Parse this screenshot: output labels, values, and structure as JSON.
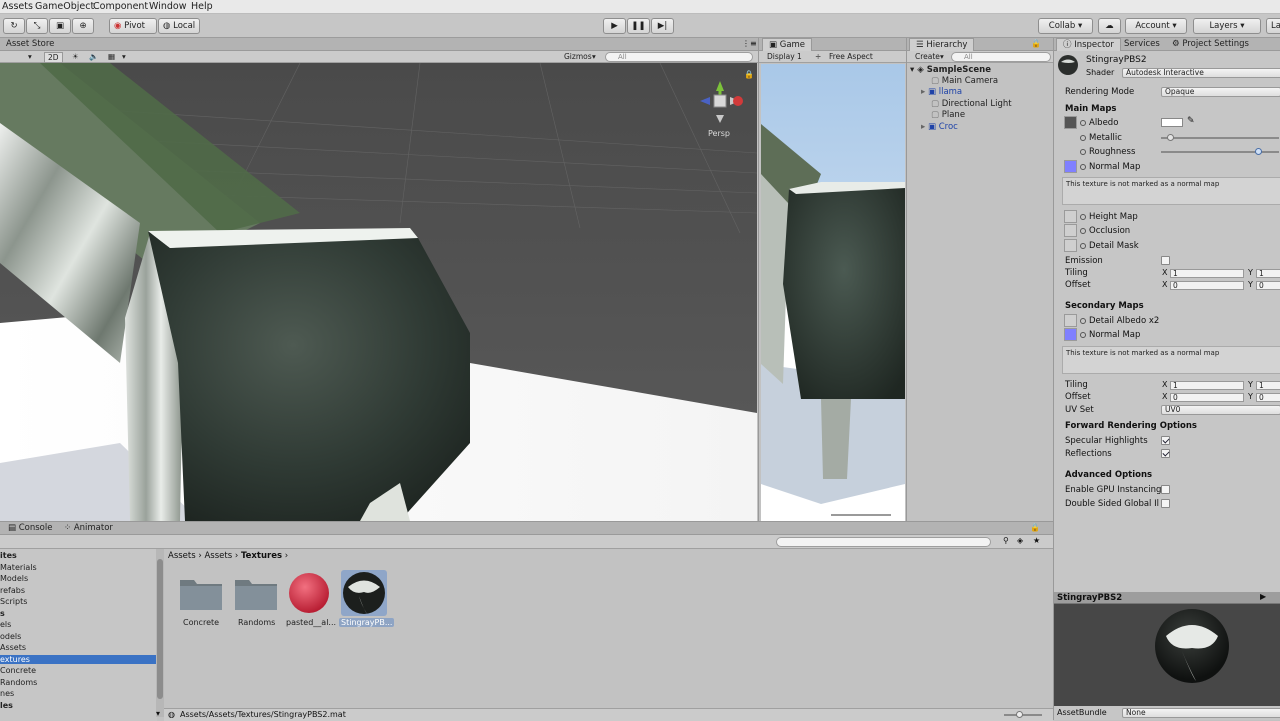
{
  "menu": [
    "Assets",
    "GameObject",
    "Component",
    "Window",
    "Help"
  ],
  "toolbar": {
    "pivot": "Pivot",
    "local": "Local",
    "collab": "Collab",
    "account": "Account",
    "layers": "Layers",
    "layout": "La"
  },
  "scene": {
    "tab": "Asset Store",
    "mode_2d": "2D",
    "gizmos": "Gizmos",
    "search_placeholder": "All",
    "persp": "Persp"
  },
  "game": {
    "tab": "Game",
    "display": "Display 1",
    "aspect": "Free Aspect"
  },
  "hierarchy": {
    "tab": "Hierarchy",
    "create": "Create",
    "search_placeholder": "All",
    "scene": "SampleScene",
    "items": [
      {
        "label": "Main Camera",
        "color": "#222222"
      },
      {
        "label": "llama",
        "color": "#1f43a8"
      },
      {
        "label": "Directional Light",
        "color": "#222222"
      },
      {
        "label": "Plane",
        "color": "#222222"
      },
      {
        "label": "Croc",
        "color": "#1f43a8"
      }
    ]
  },
  "inspector": {
    "tabs": [
      "Inspector",
      "Services",
      "Project Settings"
    ],
    "material_name": "StingrayPBS2",
    "shader_label": "Shader",
    "shader_value": "Autodesk Interactive",
    "rendering_mode_label": "Rendering Mode",
    "rendering_mode_value": "Opaque",
    "main_maps": "Main Maps",
    "albedo": "Albedo",
    "metallic": "Metallic",
    "metallic_value": 0.08,
    "roughness": "Roughness",
    "roughness_value": 0.82,
    "normal_map": "Normal Map",
    "normal_note": "This texture is not marked as a normal map",
    "height_map": "Height Map",
    "occlusion": "Occlusion",
    "detail_mask": "Detail Mask",
    "emission": "Emission",
    "tiling": "Tiling",
    "offset": "Offset",
    "x": "X",
    "y": "Y",
    "tiling_x": "1",
    "tiling_y": "1",
    "offset_x": "0",
    "offset_y": "0",
    "secondary_maps": "Secondary Maps",
    "detail_albedo": "Detail Albedo x2",
    "normal_map2": "Normal Map",
    "normal_note2": "This texture is not marked as a normal map",
    "tiling2_x": "1",
    "tiling2_y": "1",
    "offset2_x": "0",
    "offset2_y": "0",
    "uv_set_label": "UV Set",
    "uv_set_value": "UV0",
    "forward_options": "Forward Rendering Options",
    "specular_highlights": "Specular Highlights",
    "reflections": "Reflections",
    "advanced_options": "Advanced Options",
    "gpu_instancing": "Enable GPU Instancing",
    "double_sided": "Double Sided Global Il",
    "preview_title": "StingrayPBS2",
    "asset_bundle_label": "AssetBundle",
    "asset_bundle_value": "None"
  },
  "project": {
    "tabs": [
      "Console",
      "Animator"
    ],
    "breadcrumb": [
      "Assets",
      "Assets",
      "Textures"
    ],
    "tree": [
      "ites",
      "Materials",
      "Models",
      "refabs",
      "Scripts",
      "s",
      "els",
      "odels",
      "Assets",
      "extures",
      "Concrete",
      "Randoms",
      "nes",
      "les"
    ],
    "items": [
      {
        "label": "Concrete",
        "kind": "folder"
      },
      {
        "label": "Randoms",
        "kind": "folder"
      },
      {
        "label": "pasted__al...",
        "kind": "red-sphere"
      },
      {
        "label": "StingrayPB...",
        "kind": "dark-sphere"
      }
    ],
    "path": "Assets/Assets/Textures/StingrayPBS2.mat"
  },
  "colors": {
    "accent_selected": "#3a72c4",
    "normal_map_swatch": "#8080ff",
    "link_blue": "#1f43a8"
  }
}
